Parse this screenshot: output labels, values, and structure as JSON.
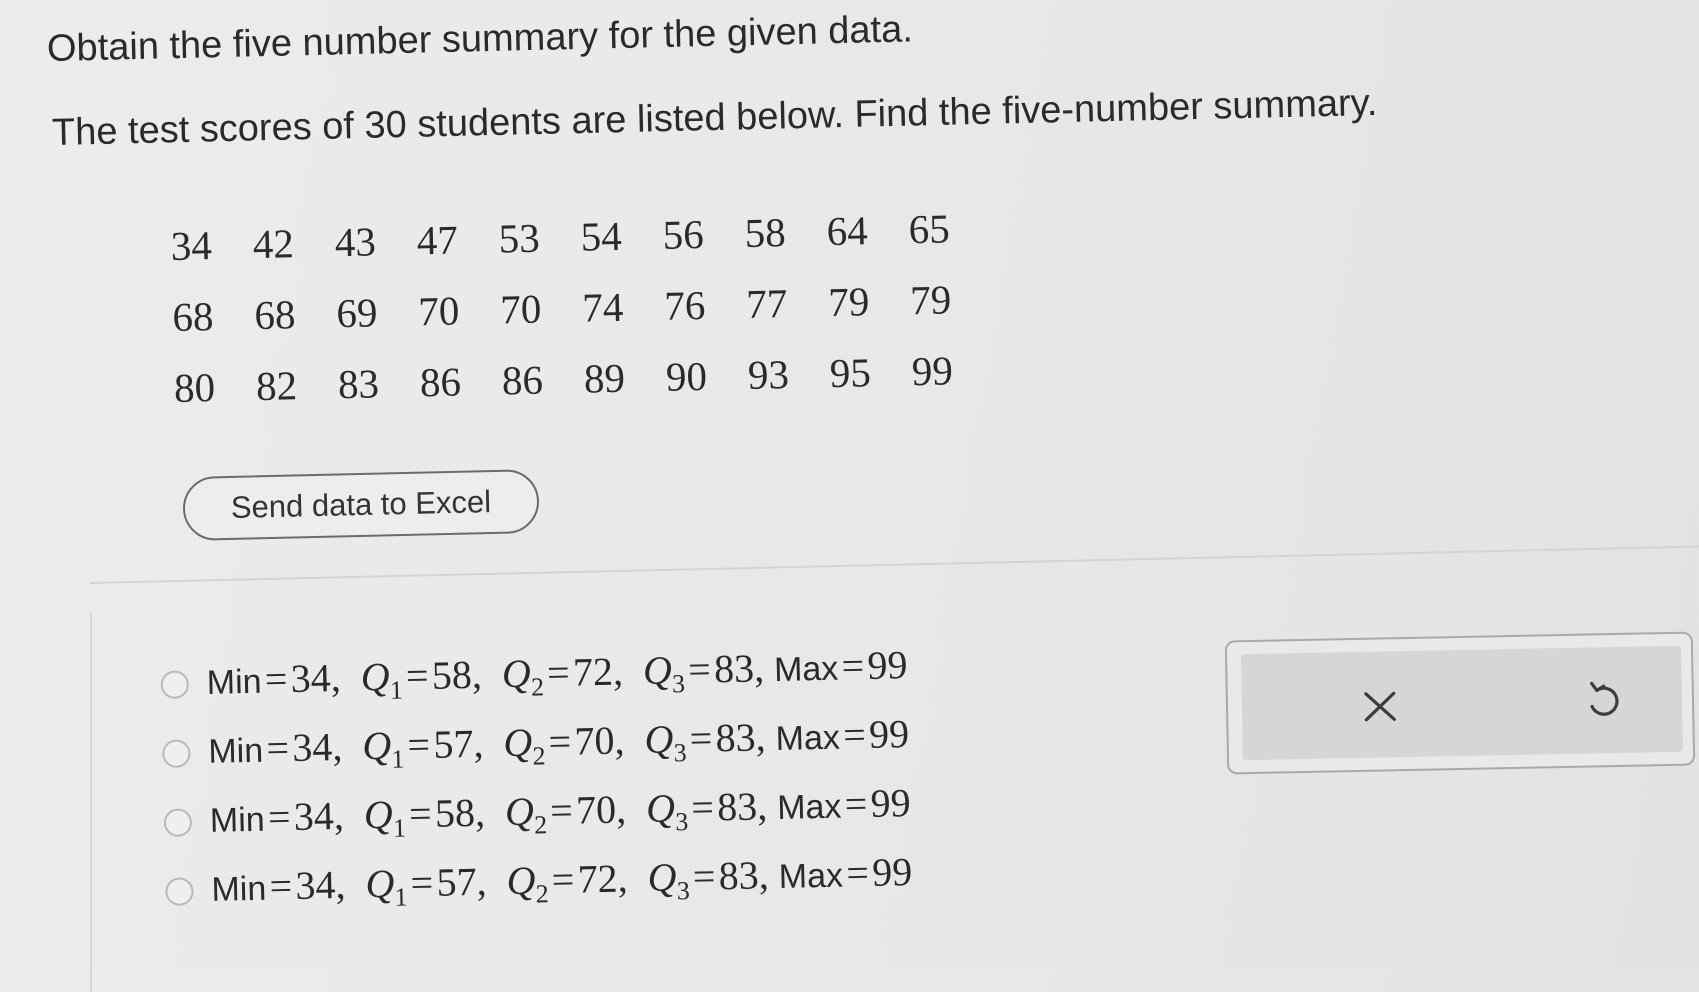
{
  "question": {
    "title": "Obtain the five number summary for the given data.",
    "description": "The test scores of 30 students are listed below. Find the five-number summary."
  },
  "data_rows": [
    [
      "34",
      "42",
      "43",
      "47",
      "53",
      "54",
      "56",
      "58",
      "64",
      "65"
    ],
    [
      "68",
      "68",
      "69",
      "70",
      "70",
      "74",
      "76",
      "77",
      "79",
      "79"
    ],
    [
      "80",
      "82",
      "83",
      "86",
      "86",
      "89",
      "90",
      "93",
      "95",
      "99"
    ]
  ],
  "excel_button": {
    "label": "Send data to Excel"
  },
  "options": [
    {
      "min": "34",
      "q1": "58",
      "q2": "72",
      "q3": "83",
      "max": "99"
    },
    {
      "min": "34",
      "q1": "57",
      "q2": "70",
      "q3": "83",
      "max": "99"
    },
    {
      "min": "34",
      "q1": "58",
      "q2": "70",
      "q3": "83",
      "max": "99"
    },
    {
      "min": "34",
      "q1": "57",
      "q2": "72",
      "q3": "83",
      "max": "99"
    }
  ],
  "option_labels": {
    "min_label": "Min",
    "max_label": "Max",
    "q_symbol": "Q"
  },
  "actions": {
    "clear_icon": "x-icon",
    "undo_icon": "undo-icon"
  },
  "colors": {
    "text": "#2a2a2a",
    "background": "#e9e9e8",
    "action_panel": "#d5d6d7"
  }
}
